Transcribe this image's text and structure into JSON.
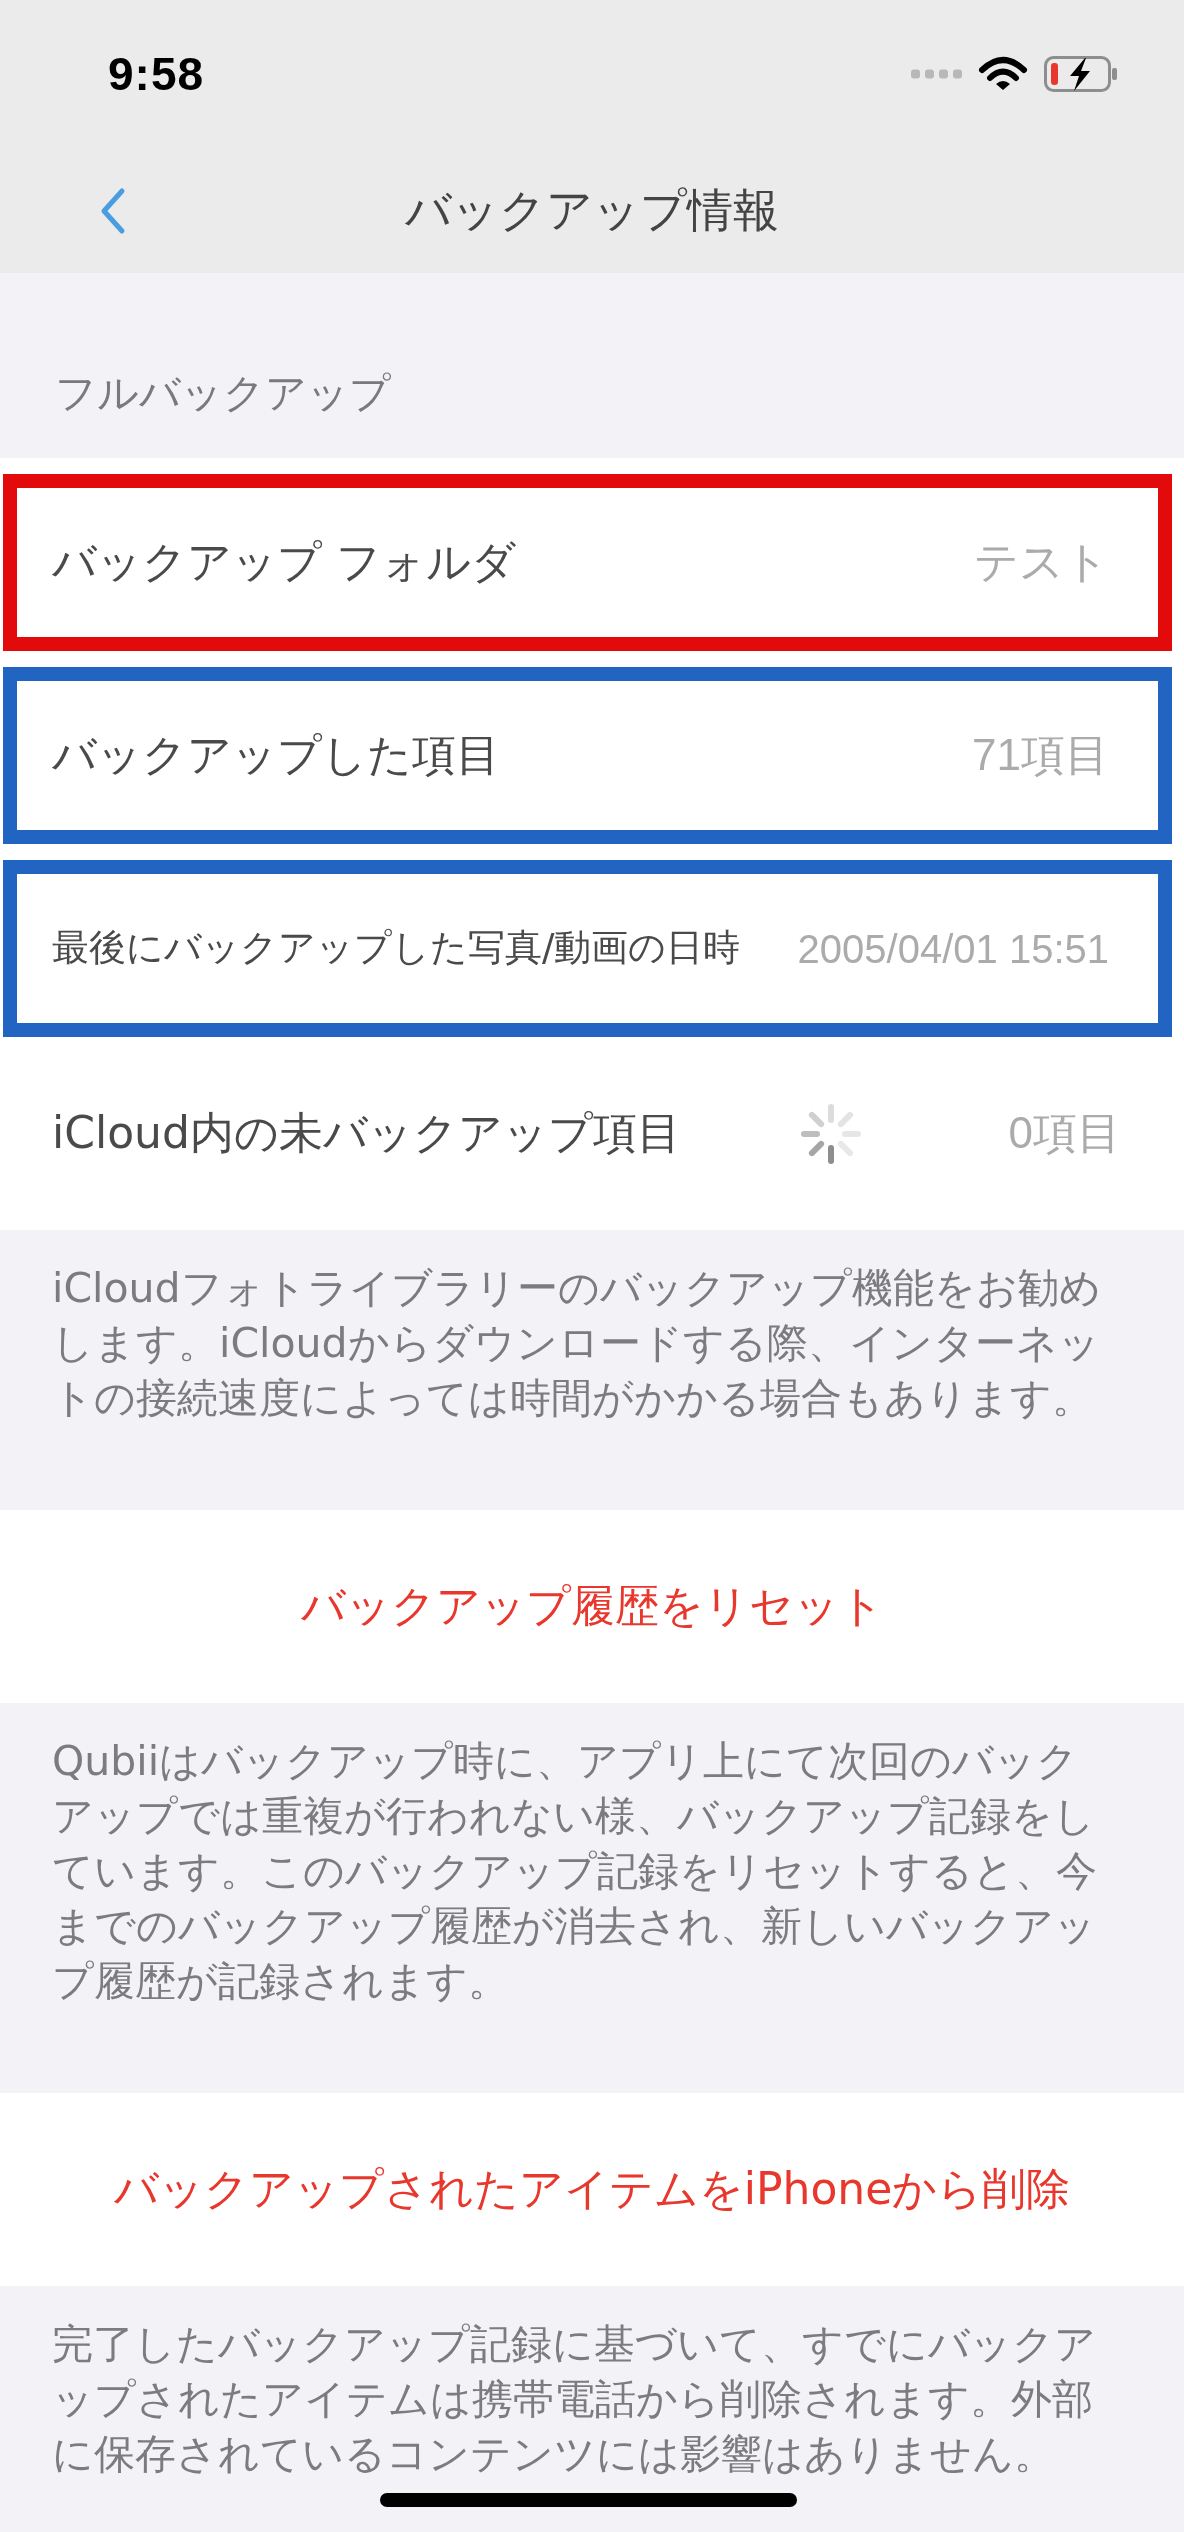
{
  "status_bar": {
    "time": "9:58"
  },
  "nav_bar": {
    "title": "バックアップ情報"
  },
  "section": {
    "header": "フルバックアップ",
    "rows": [
      {
        "kind": "standard",
        "label": "バックアップ フォルダ",
        "value": "テスト",
        "loading": false,
        "color": "#e20a0a"
      },
      {
        "kind": "standard",
        "label": "バックアップした項目",
        "value": "71項目",
        "loading": false,
        "color": "#2164c1"
      },
      {
        "kind": "compact",
        "label": "最後にバックアップした写真/動画の日時",
        "value": "2005/04/01 15:51",
        "loading": false,
        "color": "#2164c1"
      },
      {
        "kind": "standard",
        "label": "iCloud内の未バックアップ項目",
        "value": "0項目",
        "loading": true
      }
    ],
    "footer": "iCloudフォトライブラリーのバックアップ機能をお勧めします。iCloudからダウンロードする際、インターネットの接続速度によっては時間がかかる場合もあります。"
  },
  "actions": [
    {
      "label": "バックアップ履歴をリセット",
      "footer": "Qubiiはバックアップ時に、アプリ上にて次回のバックアップでは重複が行われない様、バックアップ記録をしています。このバックアップ記録をリセットすると、今までのバックアップ履歴が消去され、新しいバックアップ履歴が記録されます。"
    },
    {
      "label": "バックアップされたアイテムをiPhoneから削除",
      "footer": "完了したバックアップ記録に基づいて、すでにバックアップされたアイテムは携帯電話から削除されます。外部に保存されているコンテンツには影響はありません。"
    }
  ]
}
